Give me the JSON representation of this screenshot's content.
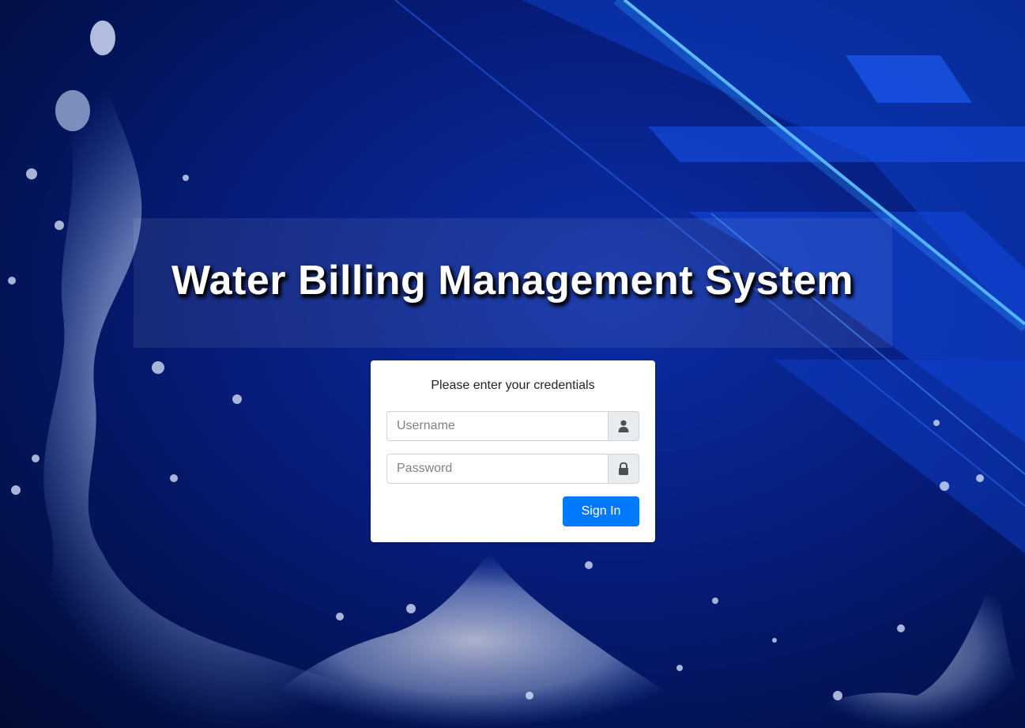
{
  "header": {
    "title": "Water Billing Management System"
  },
  "login": {
    "message": "Please enter your credentials",
    "username_placeholder": "Username",
    "username_value": "",
    "password_placeholder": "Password",
    "password_value": "",
    "signin_label": "Sign In"
  },
  "icons": {
    "username": "user-icon",
    "password": "lock-icon"
  },
  "colors": {
    "primary_button": "#007bff",
    "background_dark": "#031252",
    "addon_bg": "#e9ecef"
  }
}
